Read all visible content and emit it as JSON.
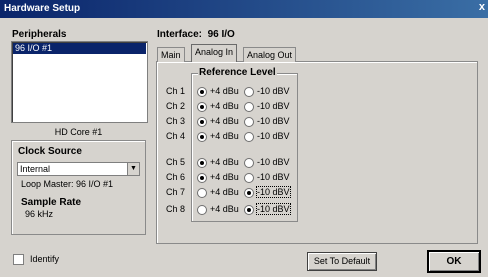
{
  "window": {
    "title": "Hardware Setup",
    "close": "x"
  },
  "peripherals": {
    "heading": "Peripherals",
    "items": [
      "96 I/O #1"
    ]
  },
  "hd_core": "HD Core #1",
  "clock": {
    "heading": "Clock Source",
    "selected": "Internal",
    "loop_master": "Loop Master: 96 I/O #1",
    "sample_rate_heading": "Sample Rate",
    "sample_rate": "96 kHz"
  },
  "interface": {
    "label": "Interface:",
    "name": "96 I/O"
  },
  "tabs": [
    {
      "label": "Main",
      "active": false
    },
    {
      "label": "Analog In",
      "active": true
    },
    {
      "label": "Analog Out",
      "active": false
    }
  ],
  "reference_level": {
    "heading": "Reference Level",
    "options": [
      "+4 dBu",
      "-10 dBV"
    ],
    "channels": [
      {
        "label": "Ch 1",
        "selected": "+4 dBu"
      },
      {
        "label": "Ch 2",
        "selected": "+4 dBu"
      },
      {
        "label": "Ch 3",
        "selected": "+4 dBu"
      },
      {
        "label": "Ch 4",
        "selected": "+4 dBu"
      },
      {
        "label": "Ch 5",
        "selected": "+4 dBu"
      },
      {
        "label": "Ch 6",
        "selected": "+4 dBu"
      },
      {
        "label": "Ch 7",
        "selected": "-10 dBV"
      },
      {
        "label": "Ch 8",
        "selected": "-10 dBV"
      }
    ]
  },
  "identify": {
    "label": "Identify",
    "checked": false
  },
  "buttons": {
    "set_default": "Set To Default",
    "ok": "OK"
  }
}
